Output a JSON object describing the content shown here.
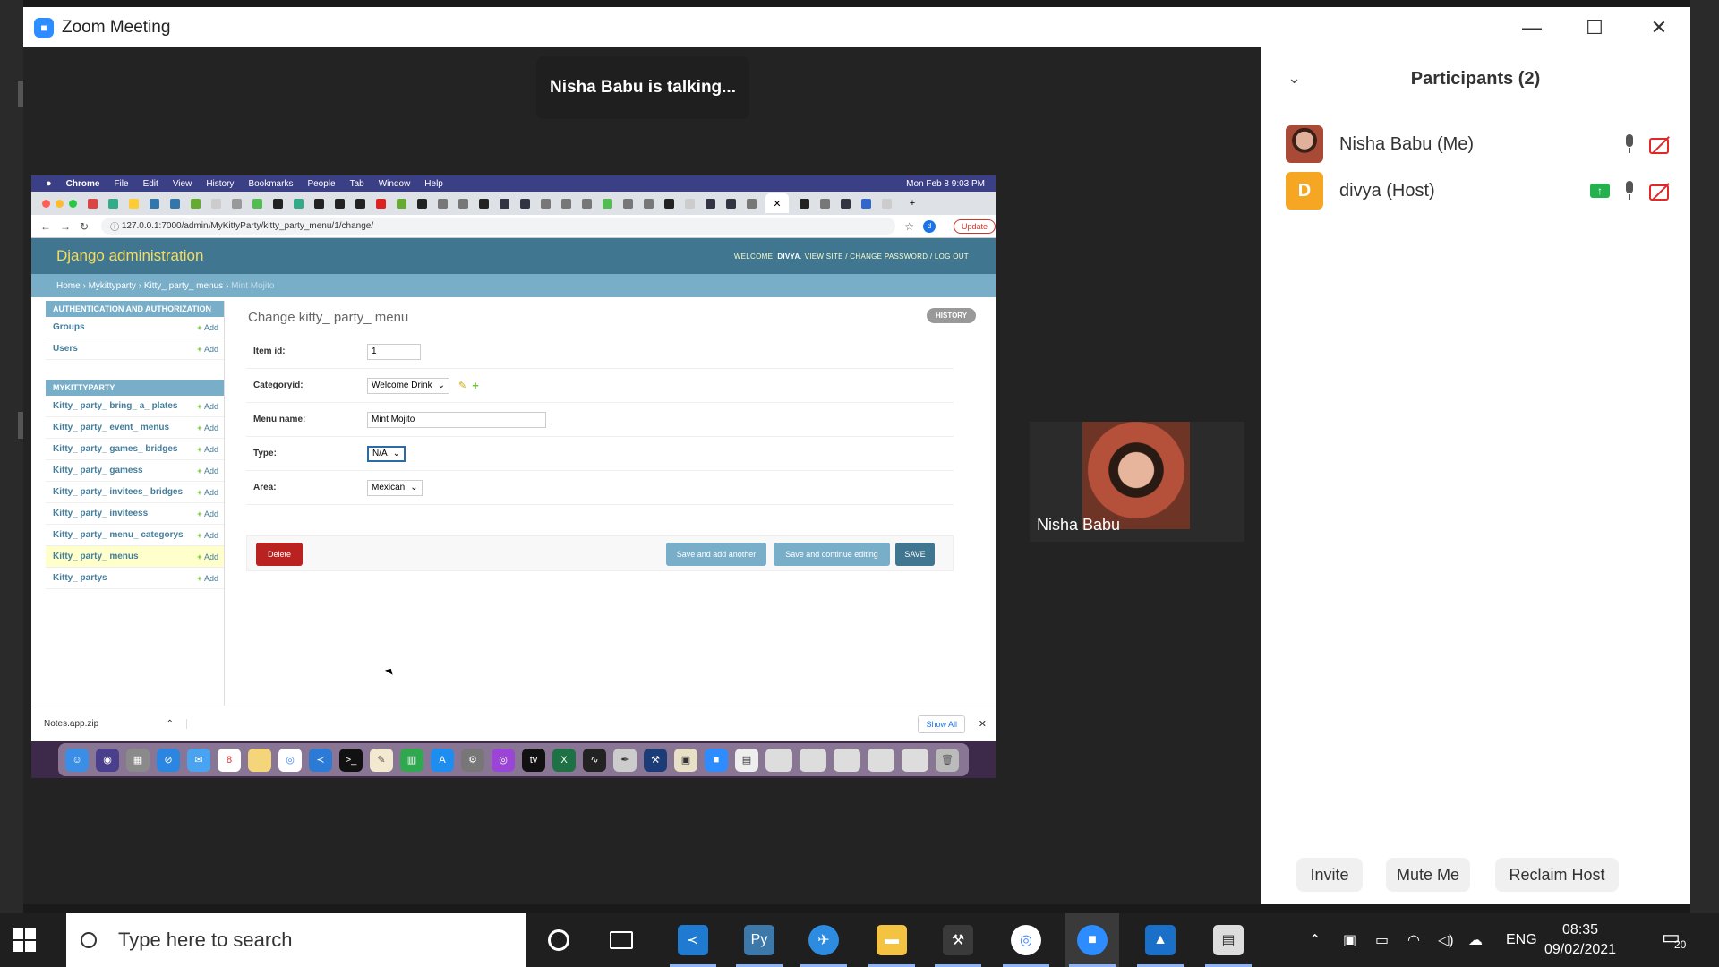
{
  "zoom": {
    "title": "Zoom Meeting",
    "controls": {
      "minimize": "—",
      "maximize": "☐",
      "close": "✕"
    },
    "talking_banner": "Nisha Babu is talking...",
    "video_tile_name": "Nisha Babu",
    "participants": {
      "title": "Participants (2)",
      "list": [
        {
          "name": "Nisha Babu (Me)",
          "avatar": "photo",
          "mic": "on",
          "video": "off"
        },
        {
          "name": "divya (Host)",
          "avatar_letter": "D",
          "sharing": true,
          "mic": "on",
          "video": "off"
        }
      ],
      "buttons": {
        "invite": "Invite",
        "mute_me": "Mute Me",
        "reclaim_host": "Reclaim Host"
      }
    }
  },
  "shared_screen": {
    "menubar": {
      "app": "Chrome",
      "items": [
        "File",
        "Edit",
        "View",
        "History",
        "Bookmarks",
        "People",
        "Tab",
        "Window",
        "Help"
      ],
      "datetime": "Mon Feb 8  9:03 PM"
    },
    "browser": {
      "url": "127.0.0.1:7000/admin/MyKittyParty/kitty_party_menu/1/change/",
      "update_label": "Update",
      "profile_letter": "d"
    },
    "django": {
      "brand": "Django administration",
      "welcome": "WELCOME,",
      "user": "DIVYA",
      "user_links": "VIEW SITE / CHANGE PASSWORD / LOG OUT",
      "breadcrumbs": {
        "home": "Home",
        "app": "Mykittyparty",
        "model": "Kitty_ party_ menus",
        "current": "Mint Mojito"
      },
      "sidebar": {
        "auth_caption": "AUTHENTICATION AND AUTHORIZATION",
        "auth_items": [
          {
            "name": "Groups",
            "add": "Add"
          },
          {
            "name": "Users",
            "add": "Add"
          }
        ],
        "app_caption": "MYKITTYPARTY",
        "app_items": [
          {
            "name": "Kitty_ party_ bring_ a_ plates",
            "add": "Add"
          },
          {
            "name": "Kitty_ party_ event_ menus",
            "add": "Add"
          },
          {
            "name": "Kitty_ party_ games_ bridges",
            "add": "Add"
          },
          {
            "name": "Kitty_ party_ gamess",
            "add": "Add"
          },
          {
            "name": "Kitty_ party_ invitees_ bridges",
            "add": "Add"
          },
          {
            "name": "Kitty_ party_ inviteess",
            "add": "Add"
          },
          {
            "name": "Kitty_ party_ menu_ categorys",
            "add": "Add"
          },
          {
            "name": "Kitty_ party_ menus",
            "add": "Add"
          },
          {
            "name": "Kitty_ partys",
            "add": "Add"
          }
        ]
      },
      "form": {
        "heading": "Change kitty_ party_ menu",
        "history": "HISTORY",
        "fields": {
          "item_id": {
            "label": "Item id:",
            "value": "1"
          },
          "categoryid": {
            "label": "Categoryid:",
            "value": "Welcome Drink"
          },
          "menu_name": {
            "label": "Menu name:",
            "value": "Mint Mojito"
          },
          "type": {
            "label": "Type:",
            "value": "N/A"
          },
          "area": {
            "label": "Area:",
            "value": "Mexican"
          }
        },
        "buttons": {
          "delete": "Delete",
          "save_add": "Save and add another",
          "save_continue": "Save and continue editing",
          "save": "SAVE"
        }
      }
    },
    "downloads": {
      "file": "Notes.app.zip",
      "show_all": "Show All",
      "close": "✕"
    },
    "dock": {
      "calendar_day": "8"
    }
  },
  "taskbar": {
    "search_placeholder": "Type here to search",
    "language": "ENG",
    "time": "08:35",
    "date": "09/02/2021",
    "notifications": "20"
  }
}
